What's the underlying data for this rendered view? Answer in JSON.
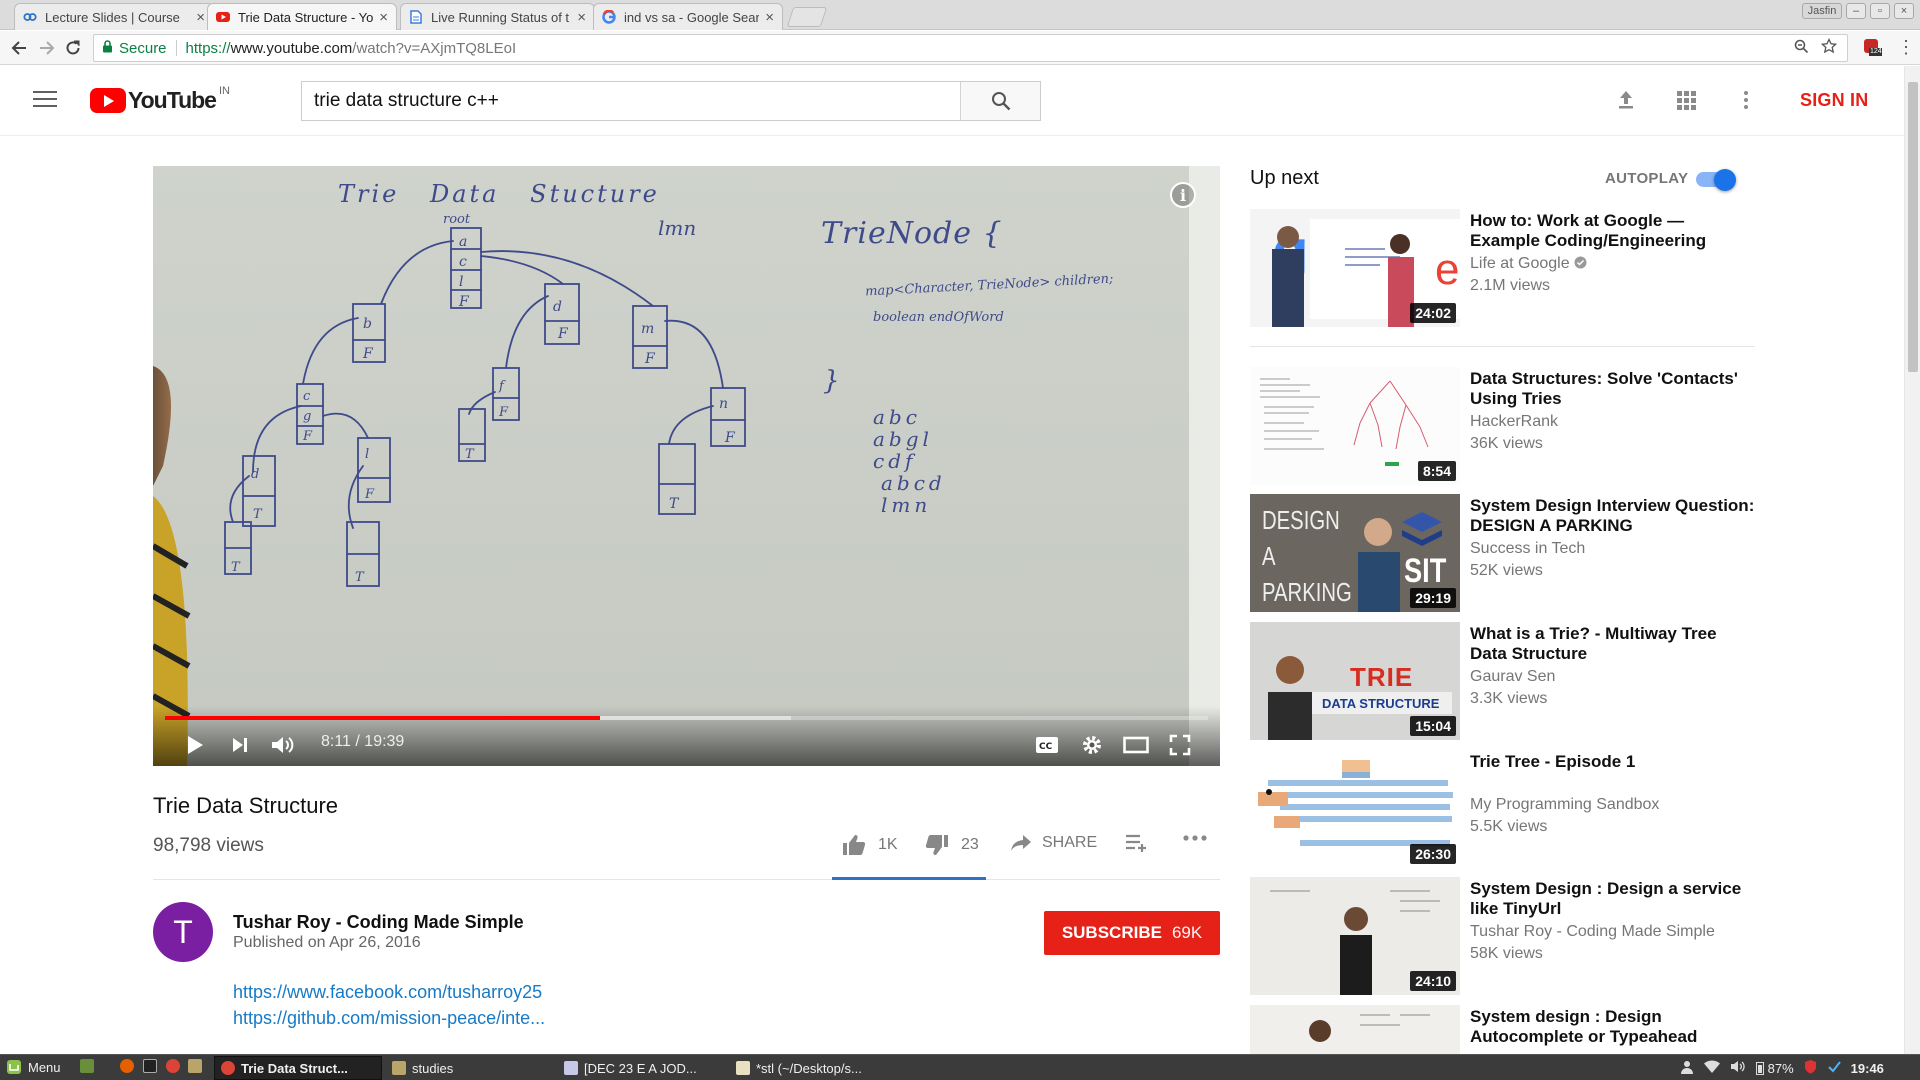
{
  "browser": {
    "tabs": [
      {
        "title": "Lecture Slides | Course",
        "favicon": "coursera-icon",
        "active": false
      },
      {
        "title": "Trie Data Structure - Yo",
        "favicon": "youtube-icon",
        "active": true
      },
      {
        "title": "Live Running Status of t",
        "favicon": "document-icon",
        "active": false
      },
      {
        "title": "ind vs sa - Google Searc",
        "favicon": "google-icon",
        "active": false
      }
    ],
    "profile_name": "Jasfin",
    "secure_label": "Secure",
    "url_prefix": "https://",
    "url_host": "www.youtube.com",
    "url_path": "/watch?v=AXjmTQ8LEoI",
    "extension_badge": "124"
  },
  "youtube": {
    "logo_text": "YouTube",
    "country_code": "IN",
    "search_value": "trie data structure c++",
    "sign_in": "SIGN IN"
  },
  "player": {
    "current_time": "8:11",
    "duration": "19:39",
    "time_display": "8:11 / 19:39",
    "progress_fraction": 0.417,
    "info_label": "i"
  },
  "whiteboard": {
    "heading": "Trie Data Stucture",
    "root_label": "root",
    "query_word": "lmn",
    "class_name": "TrieNode {",
    "member1": "map<Character, TrieNode> children;",
    "member2": "boolean endOfWord",
    "close_brace": "}",
    "words": [
      "abc",
      "abgl",
      "cdf",
      "abcd",
      "lmn"
    ]
  },
  "video": {
    "title": "Trie Data Structure",
    "views": "98,798 views",
    "likes": "1K",
    "dislikes": "23",
    "share_label": "SHARE"
  },
  "channel": {
    "avatar_letter": "T",
    "name": "Tushar Roy - Coding Made Simple",
    "published": "Published on Apr 26, 2016",
    "subscribe_label": "SUBSCRIBE",
    "subscriber_count": "69K",
    "links": [
      "https://www.facebook.com/tusharroy25",
      "https://github.com/mission-peace/inte..."
    ]
  },
  "sidebar": {
    "up_next": "Up next",
    "autoplay_label": "AUTOPLAY",
    "autoplay_on": true,
    "videos": [
      {
        "title": "How to: Work at Google — Example Coding/Engineering",
        "channel": "Life at Google",
        "verified": true,
        "views": "2.1M views",
        "duration": "24:02"
      },
      {
        "title": "Data Structures: Solve 'Contacts' Using Tries",
        "channel": "HackerRank",
        "verified": false,
        "views": "36K views",
        "duration": "8:54"
      },
      {
        "title": "System Design Interview Question: DESIGN A PARKING",
        "channel": "Success in Tech",
        "verified": false,
        "views": "52K views",
        "duration": "29:19",
        "thumb_text": "DESIGN A PARKING LOT",
        "thumb_badge": "SIT"
      },
      {
        "title": "What is a Trie? - Multiway Tree Data Structure",
        "channel": "Gaurav Sen",
        "verified": false,
        "views": "3.3K views",
        "duration": "15:04",
        "thumb_text": "TRIE",
        "thumb_sub": "DATA STRUCTURE"
      },
      {
        "title": "Trie Tree - Episode 1",
        "channel": "My Programming Sandbox",
        "verified": false,
        "views": "5.5K views",
        "duration": "26:30"
      },
      {
        "title": "System Design : Design a service like TinyUrl",
        "channel": "Tushar Roy - Coding Made Simple",
        "verified": false,
        "views": "58K views",
        "duration": "24:10"
      },
      {
        "title": "System design : Design Autocomplete or Typeahead",
        "channel": "",
        "verified": false,
        "views": "",
        "duration": ""
      }
    ]
  },
  "taskbar": {
    "menu_label": "Menu",
    "windows": [
      "Trie Data Struct...",
      "studies",
      "[DEC 23 E A JOD...",
      "*stl (~/Desktop/s..."
    ],
    "battery": "87%",
    "clock": "19:46"
  },
  "colors": {
    "youtube_red": "#e62117",
    "link_blue": "#167ac6",
    "secure_green": "#0b8043",
    "avatar_purple": "#7b1fa2",
    "autoplay_blue": "#1a73e8"
  }
}
